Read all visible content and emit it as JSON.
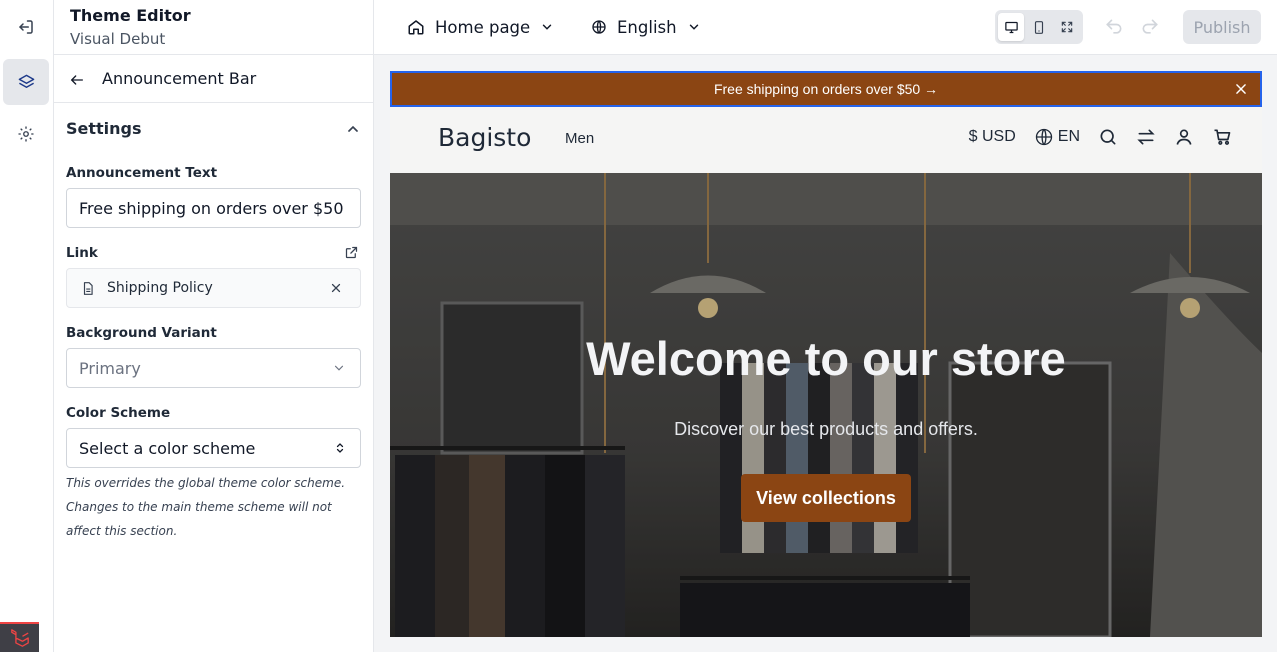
{
  "editor": {
    "title": "Theme Editor",
    "theme_name": "Visual Debut"
  },
  "toolbar": {
    "page_select": "Home page",
    "language_select": "English",
    "publish_label": "Publish"
  },
  "panel": {
    "title": "Announcement Bar",
    "settings_label": "Settings",
    "fields": {
      "announcement_text_label": "Announcement Text",
      "announcement_text_value": "Free shipping on orders over $50",
      "link_label": "Link",
      "link_value": "Shipping Policy",
      "background_variant_label": "Background Variant",
      "background_variant_value": "Primary",
      "color_scheme_label": "Color Scheme",
      "color_scheme_placeholder": "Select a color scheme",
      "color_scheme_help": "This overrides the global theme color scheme. Changes to the main theme scheme will not affect this section."
    }
  },
  "preview": {
    "announcement": "Free shipping on orders over $50 →",
    "store_logo": "Bagisto",
    "nav_links": [
      "Men"
    ],
    "currency": "$ USD",
    "locale": "EN",
    "hero_title": "Welcome to our store",
    "hero_subtitle": "Discover our best products and offers.",
    "hero_button": "View collections"
  },
  "colors": {
    "accent": "#8b4513",
    "selection_outline": "#2563eb"
  }
}
